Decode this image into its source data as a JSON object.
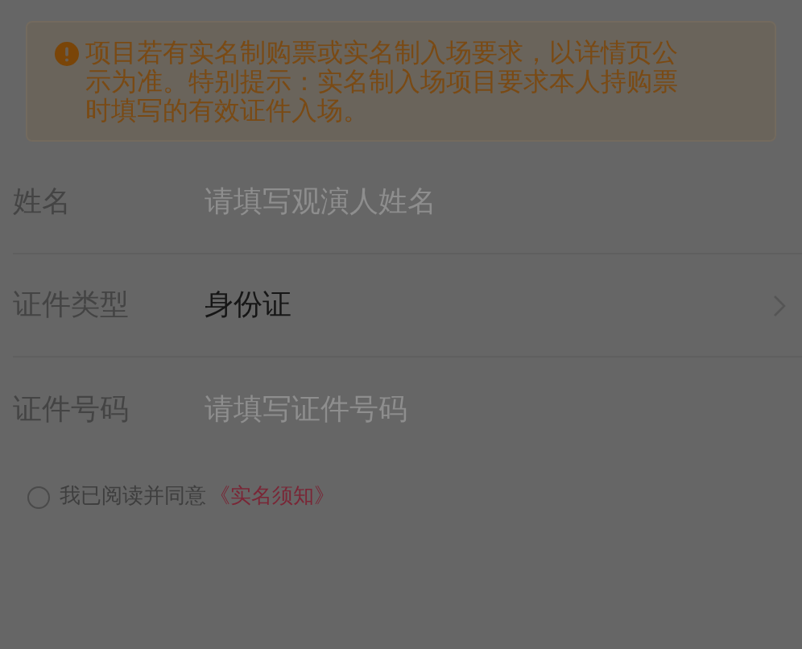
{
  "notice": {
    "text": "项目若有实名制购票或实名制入场要求，以详情页公示为准。特别提示：实名制入场项目要求本人持购票时填写的有效证件入场。"
  },
  "form": {
    "fields": [
      {
        "kind": "input",
        "label": "姓名",
        "placeholder": "请填写观演人姓名"
      },
      {
        "kind": "select",
        "label": "证件类型",
        "value": "身份证"
      },
      {
        "kind": "input",
        "label": "证件号码",
        "placeholder": "请填写证件号码"
      }
    ]
  },
  "agreement": {
    "checked": false,
    "text": "我已阅读并同意",
    "link": "《实名须知》"
  }
}
